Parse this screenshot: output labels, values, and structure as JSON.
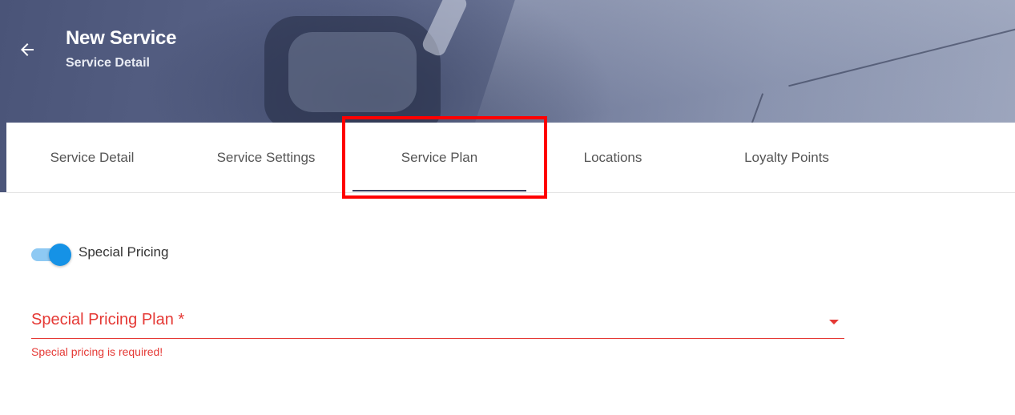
{
  "header": {
    "title": "New Service",
    "subtitle": "Service Detail"
  },
  "tabs": [
    {
      "label": "Service Detail",
      "active": false
    },
    {
      "label": "Service Settings",
      "active": false
    },
    {
      "label": "Service Plan",
      "active": true
    },
    {
      "label": "Locations",
      "active": false
    },
    {
      "label": "Loyalty Points",
      "active": false
    }
  ],
  "form": {
    "special_pricing_toggle": {
      "label": "Special Pricing",
      "checked": true
    },
    "special_pricing_plan": {
      "label": "Special Pricing Plan *",
      "value": "",
      "error": "Special pricing is required!"
    }
  },
  "colors": {
    "error": "#e53935",
    "toggle_on": "#1592e6",
    "tab_indicator": "#3a4160",
    "highlight": "#ff0000"
  },
  "icons": {
    "back": "arrow-left-icon",
    "dropdown": "caret-down-icon"
  }
}
